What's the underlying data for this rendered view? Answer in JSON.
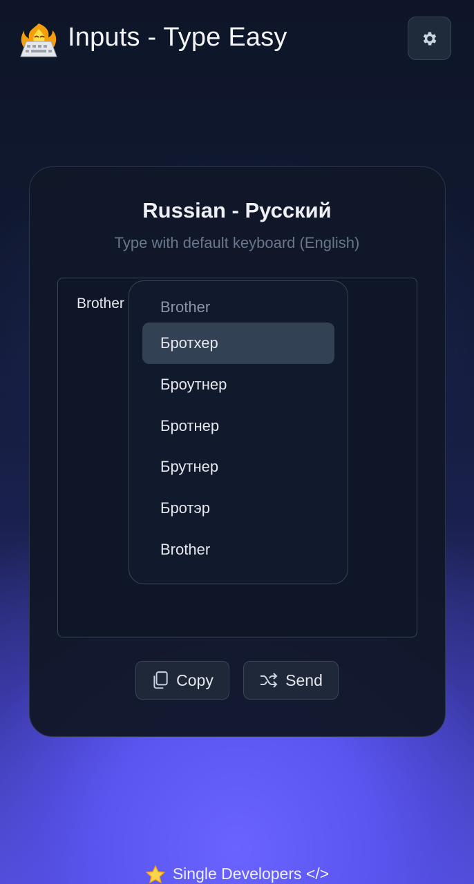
{
  "header": {
    "app_title": "Inputs - Type Easy",
    "logo_icon": "fire-keyboard-icon",
    "settings_icon": "gear-icon"
  },
  "card": {
    "title": "Russian - Русский",
    "subtitle": "Type with default keyboard (English)"
  },
  "editor": {
    "typed_text": "Brother"
  },
  "suggestions": {
    "source_word": "Brother",
    "items": [
      "Бротхер",
      "Броутнер",
      "Бротнер",
      "Брутнер",
      "Бротэр",
      "Brother"
    ],
    "selected_index": 0
  },
  "actions": {
    "copy_label": "Copy",
    "send_label": "Send",
    "copy_icon": "copy-icon",
    "send_icon": "shuffle-icon"
  },
  "footer": {
    "icon": "star-icon",
    "text": "Single Developers </>"
  },
  "colors": {
    "accent": "#6360f0",
    "card_bg": "#111728",
    "selected_bg": "#334155"
  }
}
